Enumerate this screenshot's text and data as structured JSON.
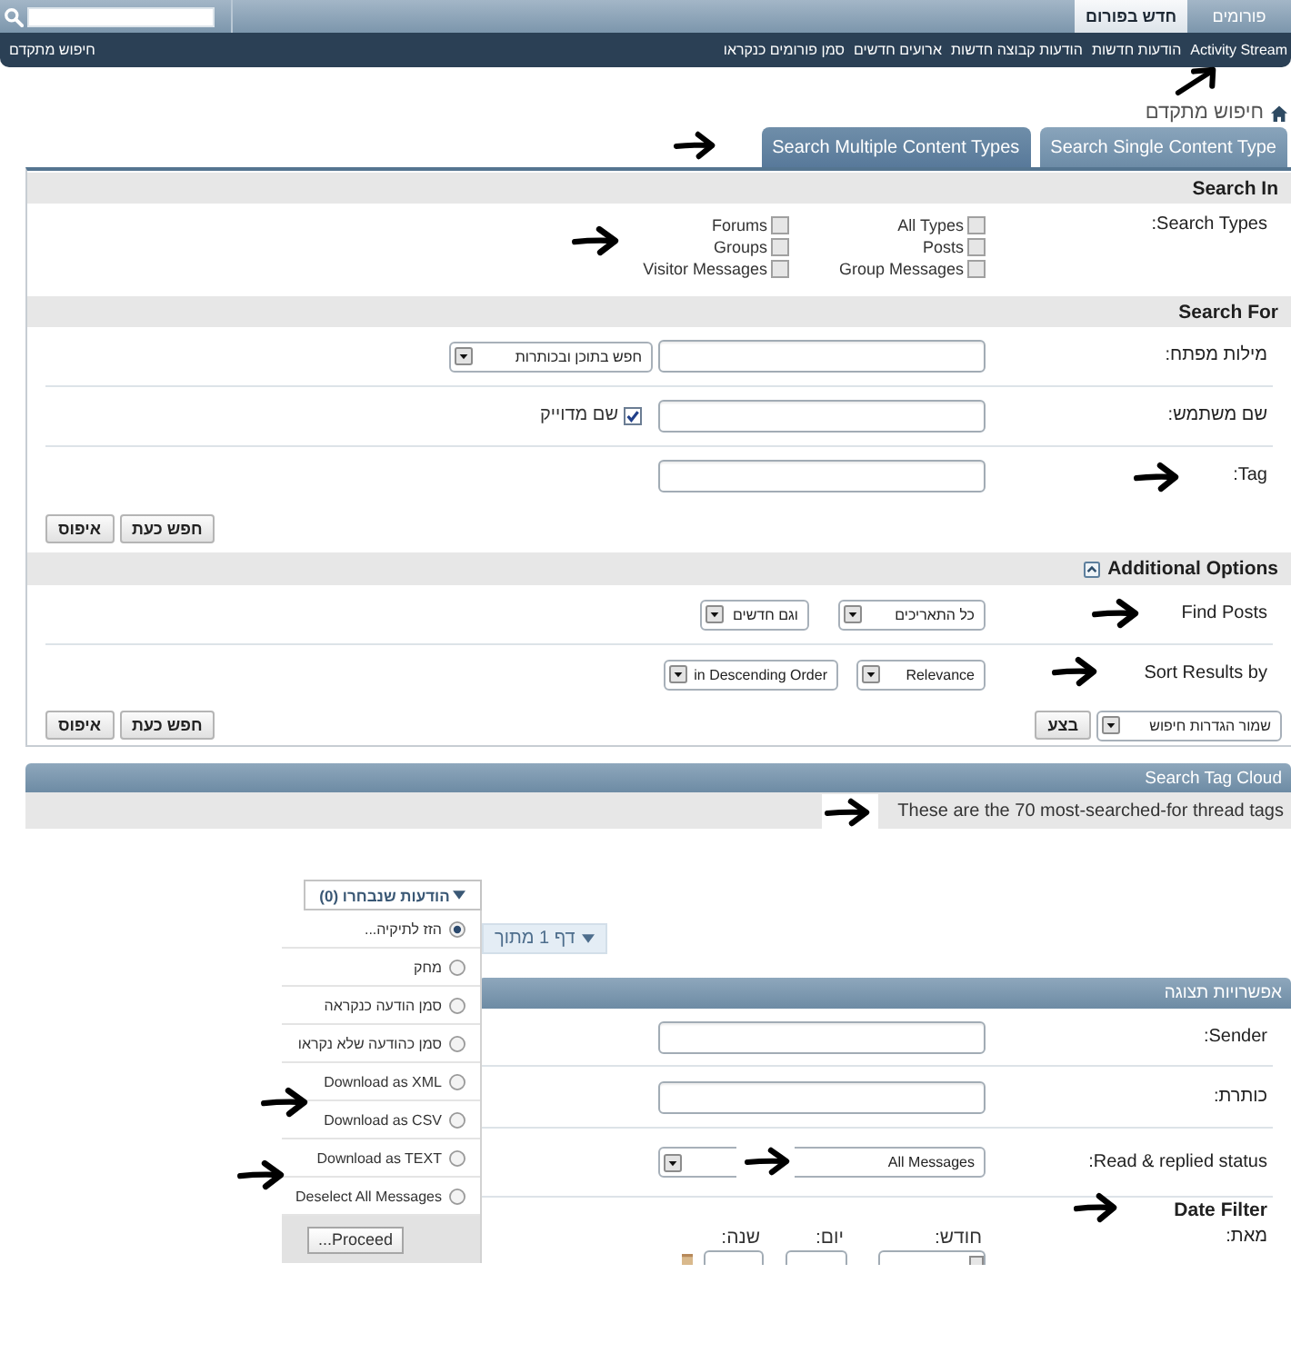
{
  "top_nav": {
    "tabs": [
      {
        "label": "פורומים",
        "selected": false
      },
      {
        "label": "חדש בפורום",
        "selected": true
      }
    ]
  },
  "sub_nav": {
    "links": [
      "Activity Stream",
      "הודעות חדשות",
      "הודעות קבוצה חדשות",
      "ארועים חדשים",
      "סמן פורומים כנקראו"
    ],
    "advanced_search": "חיפוש מתקדם"
  },
  "breadcrumb": {
    "current": "חיפוש מתקדם"
  },
  "search_tabs": [
    {
      "label": "Search Single Content Type",
      "selected": false
    },
    {
      "label": "Search Multiple Content Types",
      "selected": true
    }
  ],
  "search_in": {
    "title": "Search In",
    "label": "Search Types:",
    "types": [
      {
        "label": "All Types",
        "checked": false
      },
      {
        "label": "Posts",
        "checked": false
      },
      {
        "label": "Group Messages",
        "checked": false
      },
      {
        "label": "Forums",
        "checked": false
      },
      {
        "label": "Groups",
        "checked": false
      },
      {
        "label": "Visitor Messages",
        "checked": false
      }
    ]
  },
  "search_for": {
    "title": "Search For",
    "rows": [
      {
        "label": "מילות מפתח:",
        "dropdown": "חפש בתוכן ובכותרות"
      },
      {
        "label": "שם משתמש:",
        "checkbox": {
          "label": "שם מדוייק",
          "checked": true
        }
      },
      {
        "label": "Tag:"
      }
    ],
    "buttons": [
      "חפש כעת",
      "איפוס"
    ]
  },
  "additional_options": {
    "title": "Additional Options",
    "expanded": true,
    "rows": [
      {
        "label": "Find Posts",
        "dropdowns": [
          "כל התאריכים",
          "וגם חדשים"
        ]
      },
      {
        "label": "Sort Results by",
        "dropdowns": [
          "Relevance",
          "in Descending Order"
        ]
      }
    ],
    "save_dropdown": "שמור הגדרות חיפוש",
    "go_button": "בצע",
    "buttons": [
      "חפש כעת",
      "איפוס"
    ]
  },
  "tag_cloud": {
    "title": "Search Tag Cloud",
    "text": "These are the 70 most-searched-for thread tags"
  },
  "selected_messages": {
    "button": "הודעות שנבחרו (0)",
    "options": [
      {
        "label": "הזז לתיקיה...",
        "selected": true
      },
      {
        "label": "מחק",
        "selected": false
      },
      {
        "label": "סמן הודעה כנקראה",
        "selected": false
      },
      {
        "label": "סמן כהודעה שלא נקראו",
        "selected": false
      },
      {
        "label": "Download as XML",
        "selected": false
      },
      {
        "label": "Download as CSV",
        "selected": false
      },
      {
        "label": "Download as TEXT",
        "selected": false
      },
      {
        "label": "Deselect All Messages",
        "selected": false
      }
    ],
    "proceed": "Proceed..."
  },
  "pager": "דף 1 מתוך",
  "display_options": {
    "title": "אפשרויות תצוגה",
    "rows": [
      {
        "label": "Sender:"
      },
      {
        "label": "כותרת:"
      },
      {
        "label": "Read & replied status:",
        "dropdown": "All Messages"
      }
    ],
    "date_filter": {
      "title": "Date Filter",
      "label": "מאת:",
      "fields": [
        {
          "label": "חודש:",
          "kind": "dropdown"
        },
        {
          "label": "יום:",
          "kind": "input"
        },
        {
          "label": "שנה:",
          "kind": "input"
        }
      ]
    }
  }
}
